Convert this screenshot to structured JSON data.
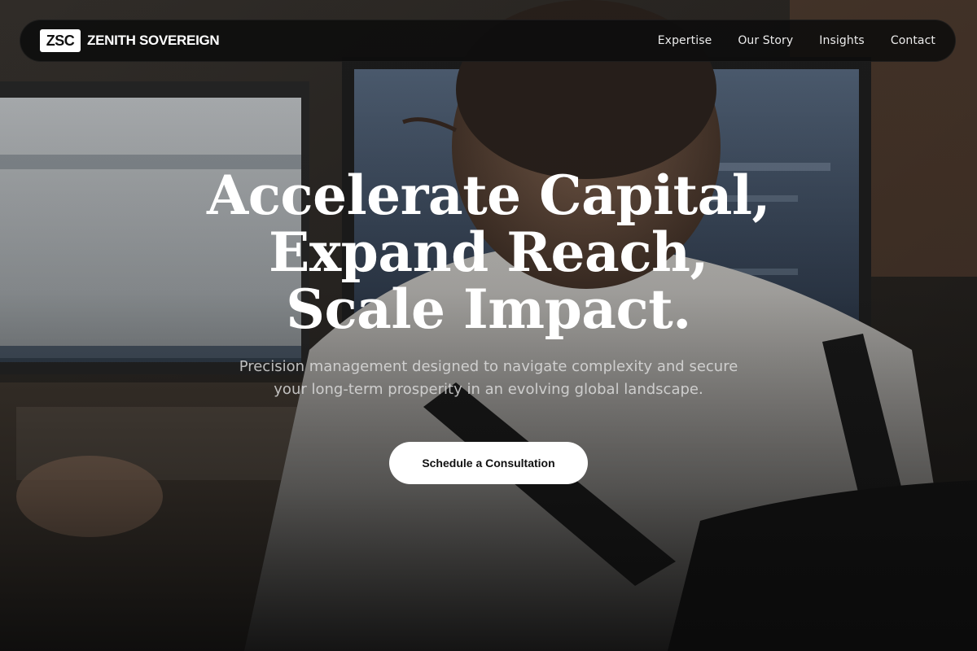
{
  "brand": {
    "logo_text": "ZSC",
    "name": "ZENITH SOVEREIGN"
  },
  "nav": {
    "items": [
      {
        "label": "Expertise"
      },
      {
        "label": "Our Story"
      },
      {
        "label": "Insights"
      },
      {
        "label": "Contact"
      }
    ]
  },
  "hero": {
    "headline_lines": [
      "Accelerate Capital,",
      "Expand Reach,",
      "Scale Impact."
    ],
    "subhead_lines": [
      "Precision management designed to navigate complexity and secure",
      "your long-term prosperity in an evolving global landscape."
    ],
    "cta_label": "Schedule a Consultation"
  },
  "colors": {
    "navbar_bg": "#0c0c0c",
    "button_bg": "#ffffff",
    "text_primary": "#ffffff",
    "page_bg": "#0b0b0b"
  }
}
